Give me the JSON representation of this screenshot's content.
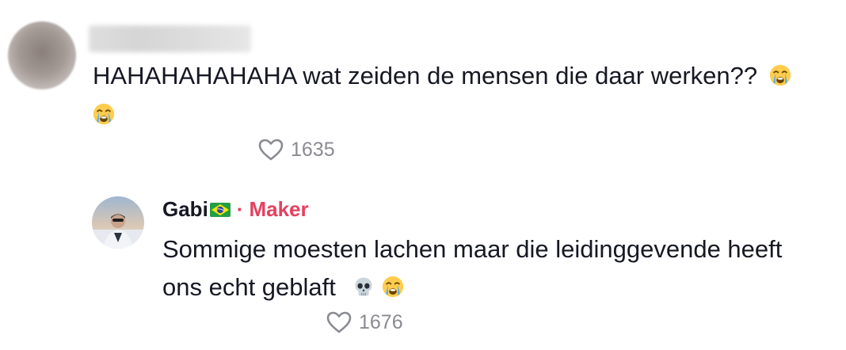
{
  "comments": [
    {
      "text_line1": "HAHAHAHAHAHA wat zeiden de mensen die daar werken??",
      "likes": "1635",
      "emojis": [
        "loudly-crying-face",
        "loudly-crying-face"
      ]
    },
    {
      "author": "Gabi",
      "author_flag": "brazil-flag",
      "separator": "·",
      "badge": "Maker",
      "text_line1": "Sommige moesten lachen maar die leidinggevende heeft",
      "text_line2": "ons echt geblaft",
      "likes": "1676",
      "emojis": [
        "skull",
        "loudly-crying-face"
      ]
    }
  ],
  "colors": {
    "text": "#161823",
    "muted": "#8a8b91",
    "badge": "#e5415e"
  }
}
